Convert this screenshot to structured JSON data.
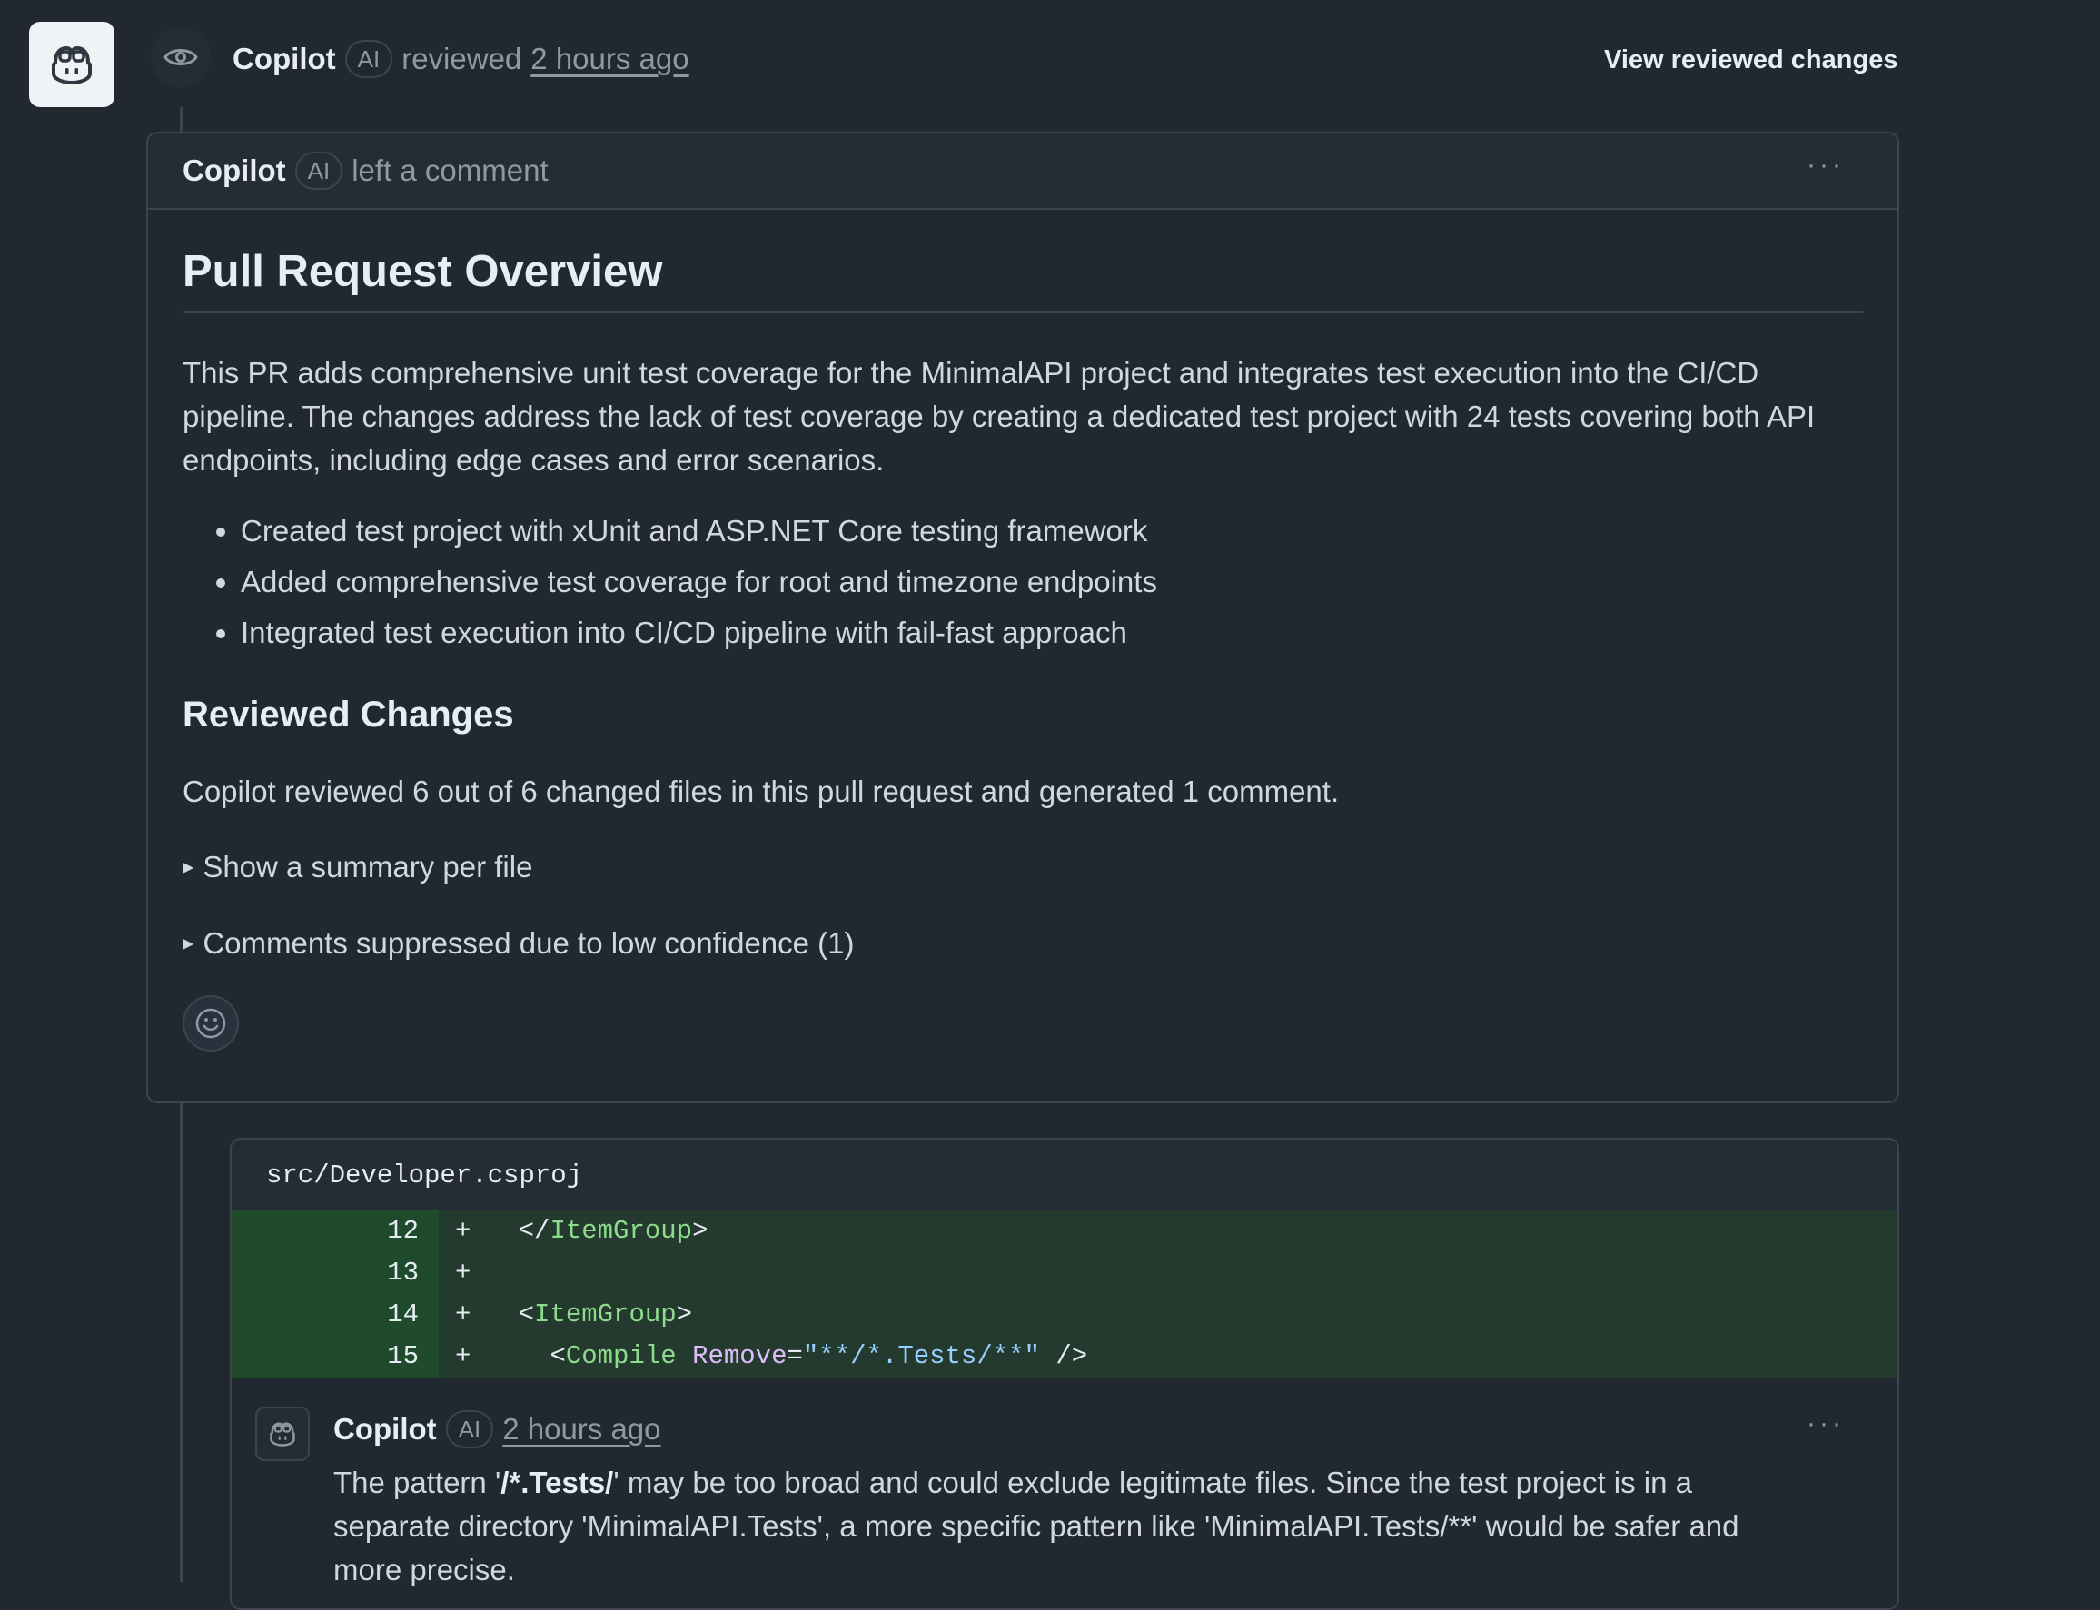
{
  "review": {
    "author": "Copilot",
    "ai_badge": "AI",
    "action": "reviewed",
    "time": "2 hours ago",
    "view_changes_label": "View reviewed changes"
  },
  "comment_card": {
    "author": "Copilot",
    "ai_badge": "AI",
    "action": "left a comment",
    "menu": "···",
    "title": "Pull Request Overview",
    "intro": "This PR adds comprehensive unit test coverage for the MinimalAPI project and integrates test execution into the CI/CD pipeline. The changes address the lack of test coverage by creating a dedicated test project with 24 tests covering both API endpoints, including edge cases and error scenarios.",
    "bullets": [
      "Created test project with xUnit and ASP.NET Core testing framework",
      "Added comprehensive test coverage for root and timezone endpoints",
      "Integrated test execution into CI/CD pipeline with fail-fast approach"
    ],
    "reviewed_heading": "Reviewed Changes",
    "reviewed_text": "Copilot reviewed 6 out of 6 changed files in this pull request and generated 1 comment.",
    "summary_toggle": "Show a summary per file",
    "suppressed_toggle": "Comments suppressed due to low confidence (1)"
  },
  "file": {
    "path": "src/Developer.csproj",
    "lines": [
      {
        "num": "12",
        "sign": "+",
        "indent": "",
        "open": "</",
        "tag": "ItemGroup",
        "attr": "",
        "eq": "",
        "value": "",
        "close": ">"
      },
      {
        "num": "13",
        "sign": "+",
        "indent": "",
        "open": "",
        "tag": "",
        "attr": "",
        "eq": "",
        "value": "",
        "close": ""
      },
      {
        "num": "14",
        "sign": "+",
        "indent": "",
        "open": "<",
        "tag": "ItemGroup",
        "attr": "",
        "eq": "",
        "value": "",
        "close": ">"
      },
      {
        "num": "15",
        "sign": "+",
        "indent": "  ",
        "open": "<",
        "tag": "Compile",
        "attr": " Remove",
        "eq": "=",
        "value": "\"**/*.Tests/**\"",
        "close": " />"
      }
    ]
  },
  "inline_comment": {
    "author": "Copilot",
    "ai_badge": "AI",
    "time": "2 hours ago",
    "menu": "···",
    "text_before": "The pattern '",
    "text_bold": "/*.Tests/",
    "text_after": "' may be too broad and could exclude legitimate files. Since the test project is in a separate directory 'MinimalAPI.Tests', a more specific pattern like 'MinimalAPI.Tests/**' would be safer and more precise."
  },
  "icons": {
    "avatar": "copilot-icon",
    "timeline": "eye-icon",
    "reaction": "smiley-icon",
    "disclosure": "triangle-right-icon"
  }
}
